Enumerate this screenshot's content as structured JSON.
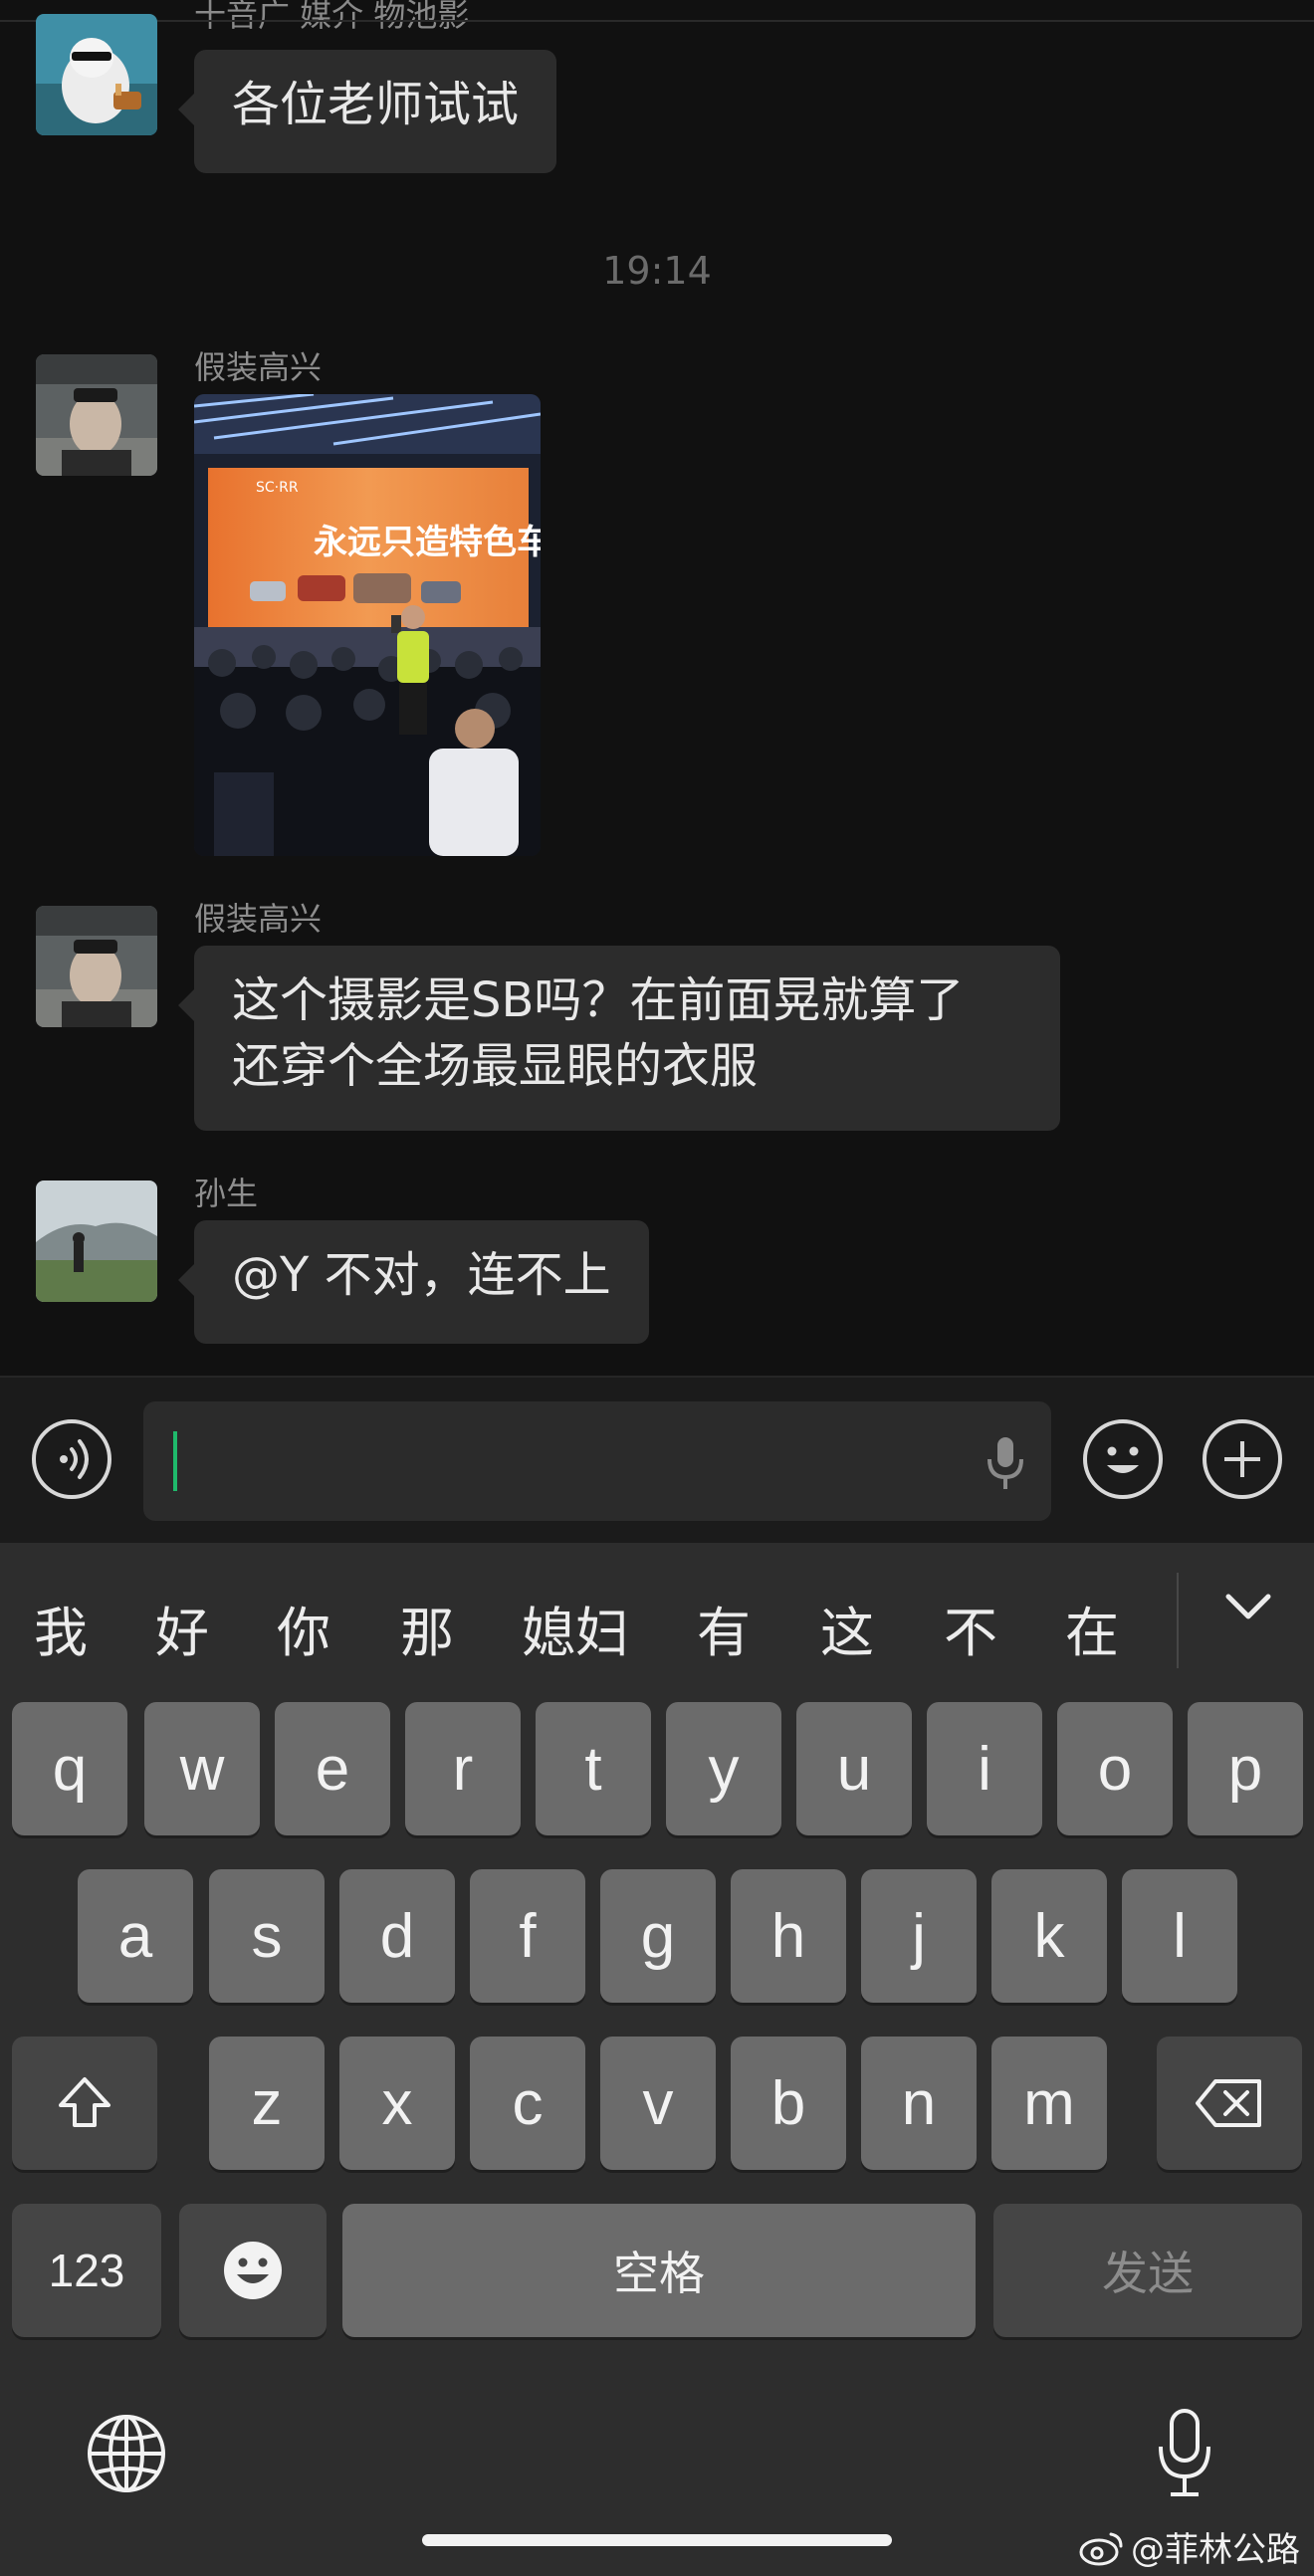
{
  "chat": {
    "cut_top_name": "十音广 媒介 物池影",
    "messages": [
      {
        "sender": "",
        "text": [
          "各位老师试试"
        ]
      },
      {
        "timestamp": "19:14"
      },
      {
        "sender": "假装高兴",
        "image": true
      },
      {
        "sender": "假装高兴",
        "text": [
          "这个摄影是SB吗？在前面晃就算了",
          "还穿个全场最显眼的衣服"
        ]
      },
      {
        "sender": "孙生",
        "text": [
          "@Y 不对，连不上"
        ]
      }
    ],
    "photo_banner": "永远只造特色车",
    "photo_logo": "SC·RR"
  },
  "input": {
    "placeholder": ""
  },
  "keyboard": {
    "candidates": [
      "我",
      "好",
      "你",
      "那",
      "媳妇",
      "有",
      "这",
      "不",
      "在"
    ],
    "row1": [
      "q",
      "w",
      "e",
      "r",
      "t",
      "y",
      "u",
      "i",
      "o",
      "p"
    ],
    "row2": [
      "a",
      "s",
      "d",
      "f",
      "g",
      "h",
      "j",
      "k",
      "l"
    ],
    "row3": [
      "z",
      "x",
      "c",
      "v",
      "b",
      "n",
      "m"
    ],
    "numbers_key": "123",
    "space_key": "空格",
    "send_key": "发送"
  },
  "watermark": "@菲林公路",
  "icons": [
    "voice-mode-icon",
    "microphone-icon",
    "emoji-icon",
    "plus-icon",
    "chevron-down-icon",
    "shift-icon",
    "backspace-icon",
    "globe-icon",
    "weibo-icon"
  ]
}
